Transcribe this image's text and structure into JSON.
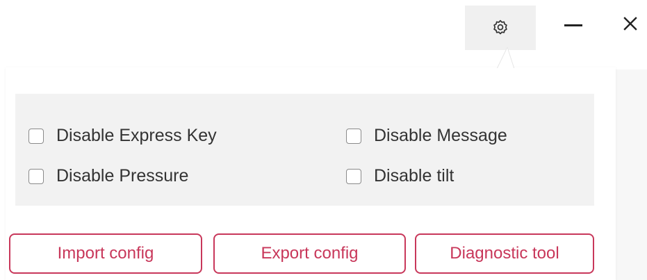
{
  "titlebar": {
    "settings_icon": "gear-icon",
    "minimize_icon": "minimize-icon",
    "close_icon": "close-icon"
  },
  "options": [
    {
      "label": "Disable Express Key",
      "checked": false
    },
    {
      "label": "Disable Message",
      "checked": false
    },
    {
      "label": "Disable Pressure",
      "checked": false
    },
    {
      "label": "Disable tilt",
      "checked": false
    }
  ],
  "buttons": {
    "import_label": "Import config",
    "export_label": "Export config",
    "diagnostic_label": "Diagnostic tool"
  },
  "colors": {
    "accent": "#c8375a",
    "panel_bg": "#f2f2f2",
    "text": "#333333"
  }
}
